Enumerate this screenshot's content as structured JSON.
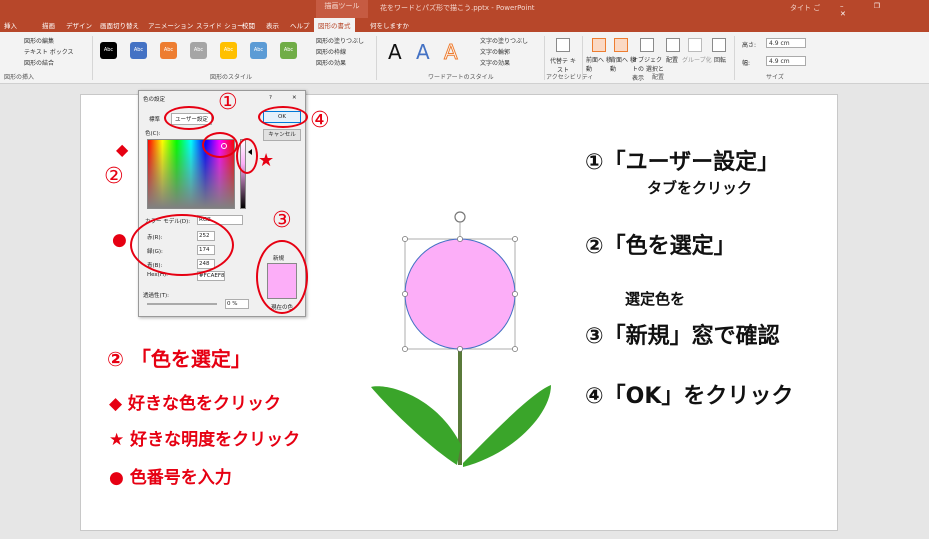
{
  "titlebar": {
    "context": "描画ツール",
    "title": "花をワードとパズ形で描こう.pptx - PowerPoint",
    "user": "タイト ご",
    "window_controls": "– ❐ ✕"
  },
  "tabs": [
    "挿入",
    "描画",
    "デザイン",
    "画面切り替え",
    "アニメーション",
    "スライド ショー",
    "校閲",
    "表示",
    "ヘルプ",
    "図形の書式",
    "何をしますか"
  ],
  "ribbon": {
    "insert_shapes": {
      "edit": "図形の編集",
      "textbox": "テキスト ボックス",
      "merge": "図形の結合",
      "label": "図形の挿入"
    },
    "styles": {
      "swatch_text": "Abc",
      "label": "図形のスタイル",
      "fill": "図形の塗りつぶし",
      "outline": "図形の枠線",
      "effect": "図形の効果",
      "swatch_colors": [
        "#000000",
        "#4472c4",
        "#ed7d31",
        "#a5a5a5",
        "#ffc000",
        "#5b9bd5",
        "#70ad47"
      ]
    },
    "wordart": {
      "letter": "A",
      "text_fill": "文字の塗りつぶし",
      "text_outline": "文字の輪郭",
      "text_effect": "文字の効果",
      "label": "ワードアートのスタイル"
    },
    "access": {
      "alt_text": "代替テ キスト",
      "label": "アクセシビリティ"
    },
    "arrange": {
      "forward": "前面へ 移動",
      "backward": "背面へ 移動",
      "pane": "オブジェクトの 選択と表示",
      "align": "配置",
      "group": "グループ化",
      "rotate": "回転",
      "label": "配置"
    },
    "size": {
      "height_label": "高さ:",
      "height": "4.9 cm",
      "width_label": "幅:",
      "width": "4.9 cm",
      "label": "サイズ"
    }
  },
  "dialog": {
    "title": "色の設定",
    "help": "?",
    "close": "✕",
    "tab_standard": "標準",
    "tab_custom": "ユーザー設定",
    "colors_label": "色(C):",
    "model_label": "カラー モデル(D):",
    "model_value": "RGB",
    "red_label": "赤(R):",
    "red": "252",
    "green_label": "緑(G):",
    "green": "174",
    "blue_label": "青(B):",
    "blue": "248",
    "hex_label": "Hex(H):",
    "hex": "#FCAEF8",
    "new_label": "新規",
    "current_label": "現在の色",
    "transparency_label": "透過性(T):",
    "transparency": "0 %",
    "ok": "OK",
    "cancel": "キャンセル"
  },
  "markers": {
    "n1": "①",
    "n2": "②",
    "n3": "③",
    "n4": "④",
    "diamond": "◆",
    "star": "★",
    "circle": "●"
  },
  "instructions": {
    "step1": "①「ユーザー設定」",
    "step1_sub": "タブをクリック",
    "step2": "②「色を選定」",
    "step3_pre": "選定色を",
    "step3": "③「新規」窓で確認",
    "step4": "④「OK」をクリック",
    "red_head": "②  「色を選定」",
    "red_diamond": "◆  好きな色をクリック",
    "red_star": "★  好きな明度をクリック",
    "red_circle": "●  色番号を入力"
  },
  "colors": {
    "accent": "#b7472a",
    "annot_red": "#e60012",
    "flower": "#fcaef8",
    "stem": "#5a7a3a",
    "leaf": "#3aa52a"
  }
}
